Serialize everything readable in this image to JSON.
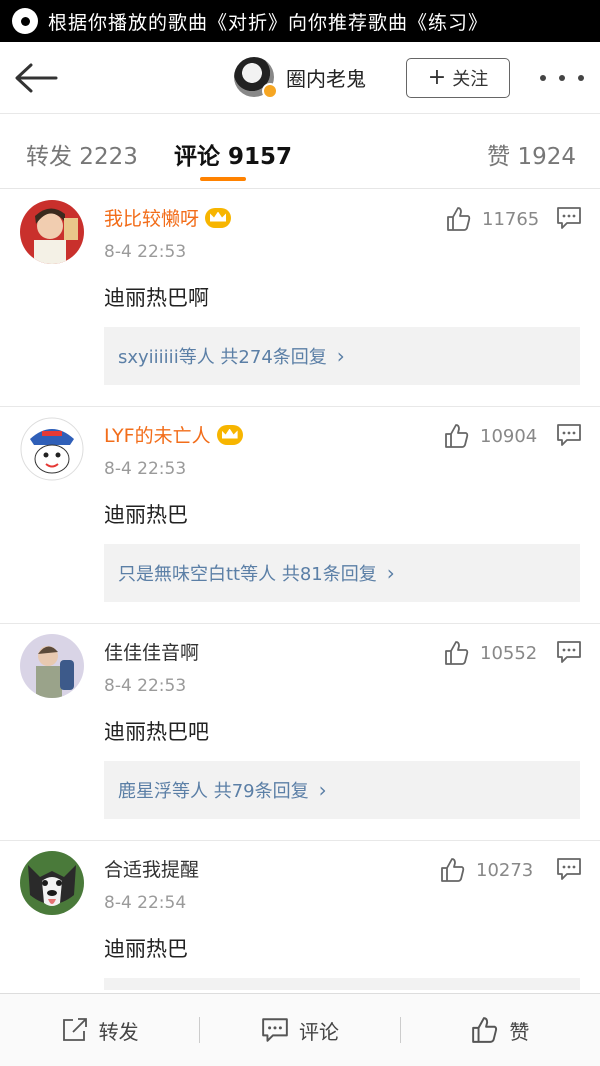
{
  "notification": {
    "text": "根据你播放的歌曲《对折》向你推荐歌曲《练习》"
  },
  "header": {
    "author_name": "圈内老鬼",
    "follow_label": "关注"
  },
  "tabs": {
    "repost": "转发 2223",
    "comments": "评论 9157",
    "likes": "赞 1924"
  },
  "comments": [
    {
      "username": "我比较懒呀",
      "vip": true,
      "time": "8-4 22:53",
      "text": "迪丽热巴啊",
      "likes": "11765",
      "replies": "sxyiiiiii等人  共274条回复"
    },
    {
      "username": "LYF的未亡人",
      "vip": true,
      "time": "8-4 22:53",
      "text": "迪丽热巴",
      "likes": "10904",
      "replies": "只是無味空白tt等人  共81条回复"
    },
    {
      "username": "佳佳佳音啊",
      "vip": false,
      "time": "8-4 22:53",
      "text": "迪丽热巴吧",
      "likes": "10552",
      "replies": "鹿星浮等人  共79条回复"
    },
    {
      "username": "合适我提醒",
      "vip": false,
      "time": "8-4 22:54",
      "text": "迪丽热巴",
      "likes": "10273",
      "replies": ""
    }
  ],
  "bottom_bar": {
    "repost": "转发",
    "comment": "评论",
    "like": "赞"
  },
  "colors": {
    "accent_orange": "#ff8200",
    "vip_name": "#f26d1a",
    "link_blue": "#5b7fa6",
    "vip_crown": "#f7b500"
  }
}
